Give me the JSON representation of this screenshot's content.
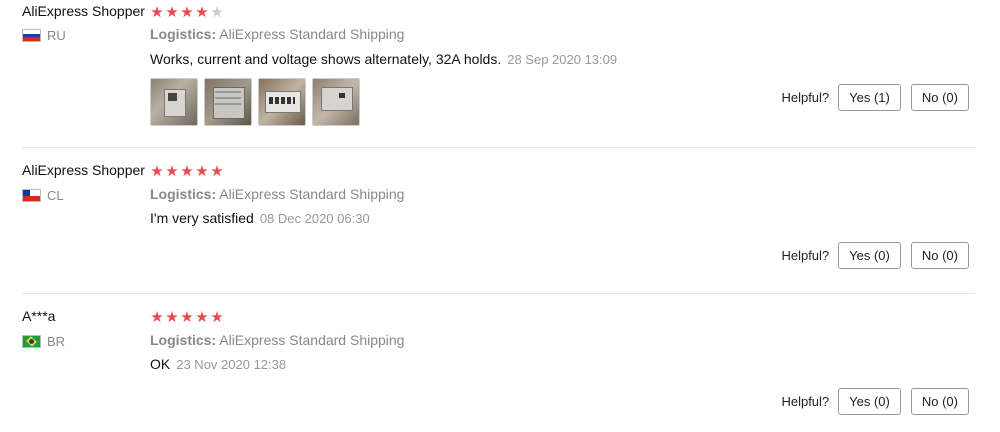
{
  "reviews": [
    {
      "name": "AliExpress Shopper",
      "rating": 4,
      "country": "RU",
      "flag_icon": "russia-flag-icon",
      "logistics_label": "Logistics:",
      "logistics_value": "AliExpress Standard Shipping",
      "comment": "Works, current and voltage shows alternately, 32A holds.",
      "date": "28 Sep 2020 13:09",
      "photos": 4,
      "helpful_label": "Helpful?",
      "yes_label": "Yes (1)",
      "no_label": "No (0)"
    },
    {
      "name": "AliExpress Shopper",
      "rating": 5,
      "country": "CL",
      "flag_icon": "chile-flag-icon",
      "logistics_label": "Logistics:",
      "logistics_value": "AliExpress Standard Shipping",
      "comment": "I'm very satisfied",
      "date": "08 Dec 2020 06:30",
      "helpful_label": "Helpful?",
      "yes_label": "Yes (0)",
      "no_label": "No (0)"
    },
    {
      "name": "A***a",
      "rating": 5,
      "country": "BR",
      "flag_icon": "brazil-flag-icon",
      "logistics_label": "Logistics:",
      "logistics_value": "AliExpress Standard Shipping",
      "comment": "OK",
      "date": "23 Nov 2020 12:38",
      "helpful_label": "Helpful?",
      "yes_label": "Yes (0)",
      "no_label": "No (0)"
    }
  ],
  "colors": {
    "star_on": "#e84b50",
    "star_off": "#cccccc"
  }
}
